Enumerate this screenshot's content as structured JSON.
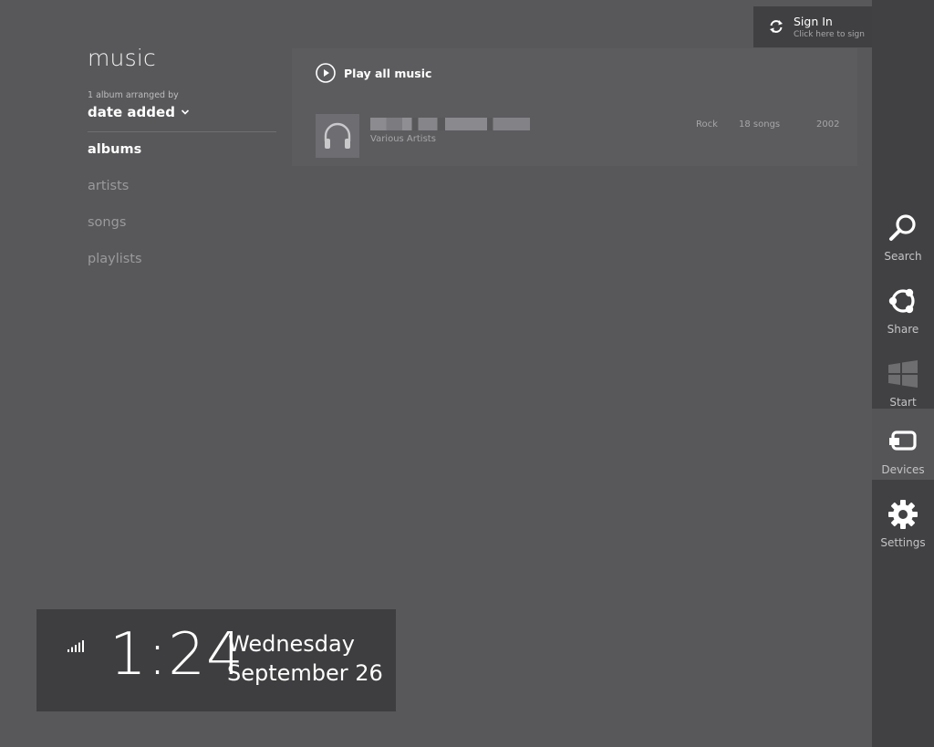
{
  "page": {
    "title": "music"
  },
  "arrange": {
    "caption": "1 album arranged by",
    "selected": "date added"
  },
  "nav": {
    "items": [
      {
        "label": "albums",
        "active": true
      },
      {
        "label": "artists",
        "active": false
      },
      {
        "label": "songs",
        "active": false
      },
      {
        "label": "playlists",
        "active": false
      }
    ]
  },
  "main": {
    "play_all_label": "Play all music",
    "album": {
      "artist": "Various Artists",
      "genre": "Rock",
      "song_count": "18 songs",
      "year": "2002",
      "art_icon": "headphones-icon"
    }
  },
  "signin": {
    "title": "Sign In",
    "subtitle": "Click here to sign"
  },
  "charms": {
    "search": "Search",
    "share": "Share",
    "start": "Start",
    "devices": "Devices",
    "settings": "Settings"
  },
  "clock": {
    "time": "1:24",
    "day": "Wednesday",
    "date": "September 26"
  },
  "colors": {
    "background": "#58585b",
    "charms_bar": "#414143",
    "clock_panel": "#3e3e40"
  }
}
